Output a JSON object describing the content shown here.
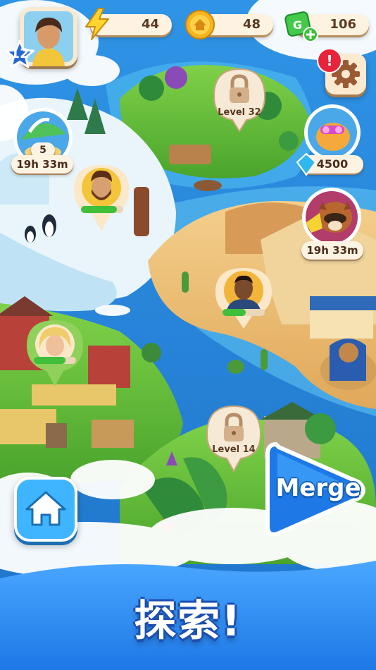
{
  "player": {
    "level": "12"
  },
  "resources": {
    "energy": "44",
    "coins": "48",
    "cash": "106"
  },
  "notification": {
    "alert": "!"
  },
  "map": {
    "snow_island": {
      "counter": "5",
      "timer": "19h 33m"
    },
    "jungle_island": {
      "lock_label": "Level 32"
    },
    "pig_reward": {
      "value": "4500"
    },
    "raccoon_event": {
      "timer": "19h 33m"
    },
    "garden_island": {
      "lock_label": "Level 14"
    },
    "character_progress": [
      0.85,
      0.55,
      0.75
    ]
  },
  "buttons": {
    "merge_label": "Merge"
  },
  "banner": {
    "title": "探索!"
  },
  "colors": {
    "ocean": "#2a86d8",
    "banner": "#2f8ff0",
    "accent_green": "#3fbf3a"
  }
}
